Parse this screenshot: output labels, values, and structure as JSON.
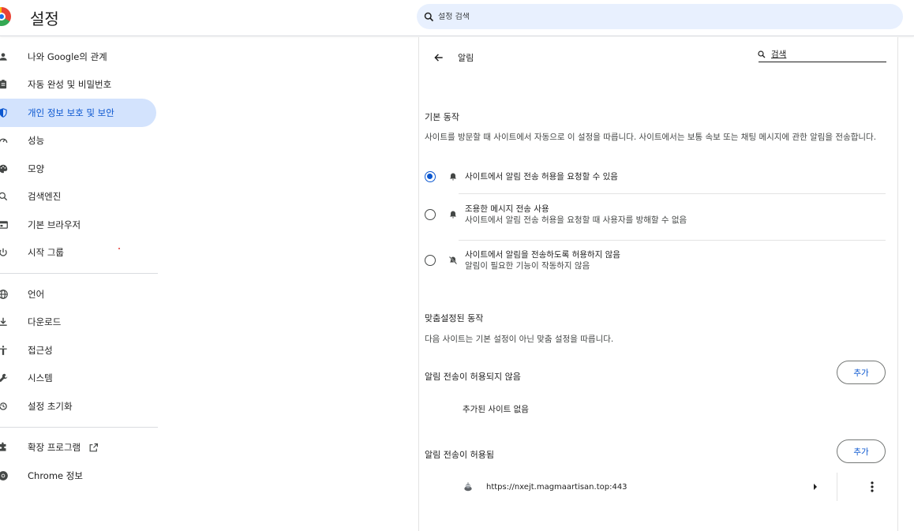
{
  "header": {
    "title": "설정",
    "search_placeholder": "설정 검색"
  },
  "sidebar": {
    "items": [
      {
        "label": "나와 Google의 관계",
        "icon": "person-icon"
      },
      {
        "label": "자동 완성 및 비밀번호",
        "icon": "clipboard-icon"
      },
      {
        "label": "개인 정보 보호 및 보안",
        "icon": "shield-icon",
        "active": true
      },
      {
        "label": "성능",
        "icon": "speedometer-icon"
      },
      {
        "label": "모양",
        "icon": "palette-icon"
      },
      {
        "label": "검색엔진",
        "icon": "search-icon"
      },
      {
        "label": "기본 브라우저",
        "icon": "browser-icon"
      },
      {
        "label": "시작 그룹",
        "icon": "power-icon"
      },
      {
        "label": "언어",
        "icon": "globe-icon"
      },
      {
        "label": "다운로드",
        "icon": "download-icon"
      },
      {
        "label": "접근성",
        "icon": "accessibility-icon"
      },
      {
        "label": "시스템",
        "icon": "wrench-icon"
      },
      {
        "label": "설정 초기화",
        "icon": "reset-icon"
      },
      {
        "label": "확장 프로그램",
        "icon": "puzzle-icon"
      },
      {
        "label": "Chrome 정보",
        "icon": "chrome-icon"
      }
    ]
  },
  "main": {
    "page_title": "알림",
    "search_label": "검색",
    "default_section": {
      "title": "기본 동작",
      "description": "사이트를 방문할 때 사이트에서 자동으로 이 설정을 따릅니다. 사이트에서는 보통 속보 또는 채팅 메시지에 관한 알림을 전송합니다.",
      "options": [
        {
          "label": "사이트에서 알림 전송 허용을 요청할 수 있음",
          "sublabel": "",
          "selected": true,
          "icon": "bell-icon"
        },
        {
          "label": "조용한 메시지 전송 사용",
          "sublabel": "사이트에서 알림 전송 허용을 요청할 때 사용자를 방해할 수 없음",
          "selected": false,
          "icon": "bell-quiet-icon"
        },
        {
          "label": "사이트에서 알림을 전송하도록 허용하지 않음",
          "sublabel": "알림이 필요한 기능이 작동하지 않음",
          "selected": false,
          "icon": "bell-off-icon"
        }
      ]
    },
    "custom_section": {
      "title": "맞춤설정된 동작",
      "description": "다음 사이트는 기본 설정이 아닌 맞춤 설정을 따릅니다.",
      "blocked": {
        "title": "알림 전송이 허용되지 않음",
        "add_label": "추가",
        "empty_text": "추가된 사이트 없음"
      },
      "allowed": {
        "title": "알림 전송이 허용됨",
        "add_label": "추가",
        "sites": [
          {
            "url": "https://nxejt.magmaartisan.top:443"
          }
        ]
      }
    }
  },
  "colors": {
    "accent": "#0b57d0",
    "active_nav_bg": "#d3e3fd",
    "search_bg": "#e8f0fe"
  }
}
